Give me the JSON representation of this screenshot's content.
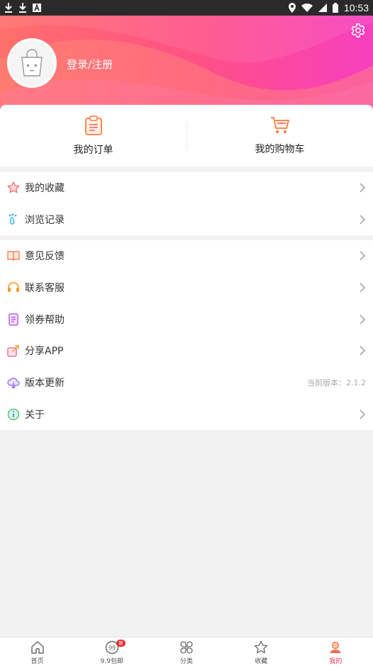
{
  "status_bar": {
    "time": "10:53"
  },
  "header": {
    "login_text": "登录/注册"
  },
  "quick": [
    {
      "label": "我的订单",
      "icon": "clipboard-icon"
    },
    {
      "label": "我的购物车",
      "icon": "cart-icon"
    }
  ],
  "group1": [
    {
      "label": "我的收藏",
      "icon": "star-icon"
    },
    {
      "label": "浏览记录",
      "icon": "footprint-icon"
    }
  ],
  "group2": [
    {
      "label": "意见反馈",
      "icon": "book-icon"
    },
    {
      "label": "联系客服",
      "icon": "headset-icon"
    },
    {
      "label": "领券帮助",
      "icon": "coupon-icon"
    },
    {
      "label": "分享APP",
      "icon": "share-icon"
    },
    {
      "label": "版本更新",
      "icon": "cloud-icon",
      "note": "当前版本：2.1.2"
    },
    {
      "label": "关于",
      "icon": "info-icon"
    }
  ],
  "nav": [
    {
      "label": "首页",
      "icon": "home-icon"
    },
    {
      "label": "9.9包邮",
      "icon": "nine-icon",
      "badge": "新"
    },
    {
      "label": "分类",
      "icon": "category-icon"
    },
    {
      "label": "收藏",
      "icon": "star-outline-icon"
    },
    {
      "label": "我的",
      "icon": "user-icon",
      "active": true
    }
  ],
  "colors": {
    "accent": "#f0305a",
    "header_start": "#ff6f6a",
    "header_end": "#f73fc0"
  }
}
